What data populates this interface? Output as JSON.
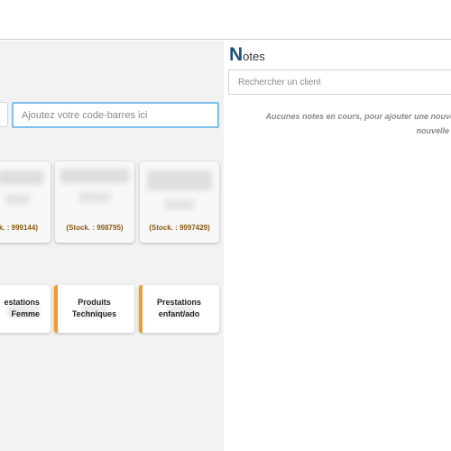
{
  "barcode": {
    "placeholder": "Ajoutez votre code-barres ici"
  },
  "products": [
    {
      "stock_text": "ck. : 999144)"
    },
    {
      "stock_text": "(Stock. : 998795)"
    },
    {
      "stock_text": "(Stock. : 9997429)"
    }
  ],
  "categories": [
    {
      "line1": "estations",
      "line2": "Femme"
    },
    {
      "line1": "Produits",
      "line2": "Techniques"
    },
    {
      "line1": "Prestations",
      "line2": "enfant/ado"
    }
  ],
  "notes": {
    "title_initial": "N",
    "title_rest": "otes",
    "search_placeholder": "Rechercher un client",
    "empty_line1": "Aucunes notes en cours, pour ajouter une nouvelle",
    "empty_line2": "nouvelle"
  },
  "colors": {
    "accent": "#f39a2b",
    "stock_text": "#8a5a12",
    "focus_border": "#7cc1ea",
    "notes_title": "#1f4e79"
  }
}
